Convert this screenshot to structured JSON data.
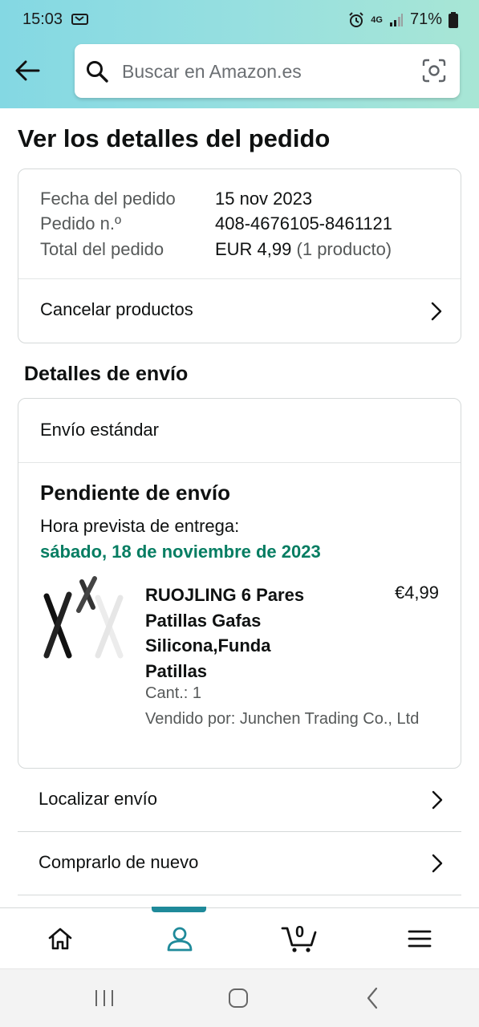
{
  "status_bar": {
    "time": "15:03",
    "battery": "71%",
    "network": "4G"
  },
  "header": {
    "search_placeholder": "Buscar en Amazon.es"
  },
  "page": {
    "title": "Ver los detalles del pedido"
  },
  "order_summary": {
    "date_label": "Fecha del pedido",
    "date_value": "15 nov 2023",
    "number_label": "Pedido n.º",
    "number_value": "408-4676105-8461121",
    "total_label": "Total del pedido",
    "total_value": "EUR 4,99",
    "total_count": "(1 producto)",
    "cancel_label": "Cancelar productos"
  },
  "shipping": {
    "section_title": "Detalles de envío",
    "method": "Envío estándar",
    "status": "Pendiente de envío",
    "eta_label": "Hora prevista de entrega:",
    "eta_date": "sábado, 18 de noviembre de 2023",
    "product": {
      "title": "RUOJLING 6 Pares Patillas Gafas Silicona,Funda Patillas",
      "price": "€4,99",
      "quantity": "Cant.: 1",
      "seller": "Vendido por: Junchen Trading Co., Ltd"
    }
  },
  "actions": {
    "track": "Localizar envío",
    "buy_again": "Comprarlo de nuevo"
  },
  "bottom_nav": {
    "items": [
      "home-icon",
      "account-icon",
      "cart-icon",
      "menu-icon"
    ],
    "active": "account-icon",
    "cart_count": "0",
    "accent_color": "#1f8a9a"
  },
  "colors": {
    "eta_green": "#067d62",
    "header_start": "#84d8e3",
    "header_end": "#a8e6d5"
  }
}
